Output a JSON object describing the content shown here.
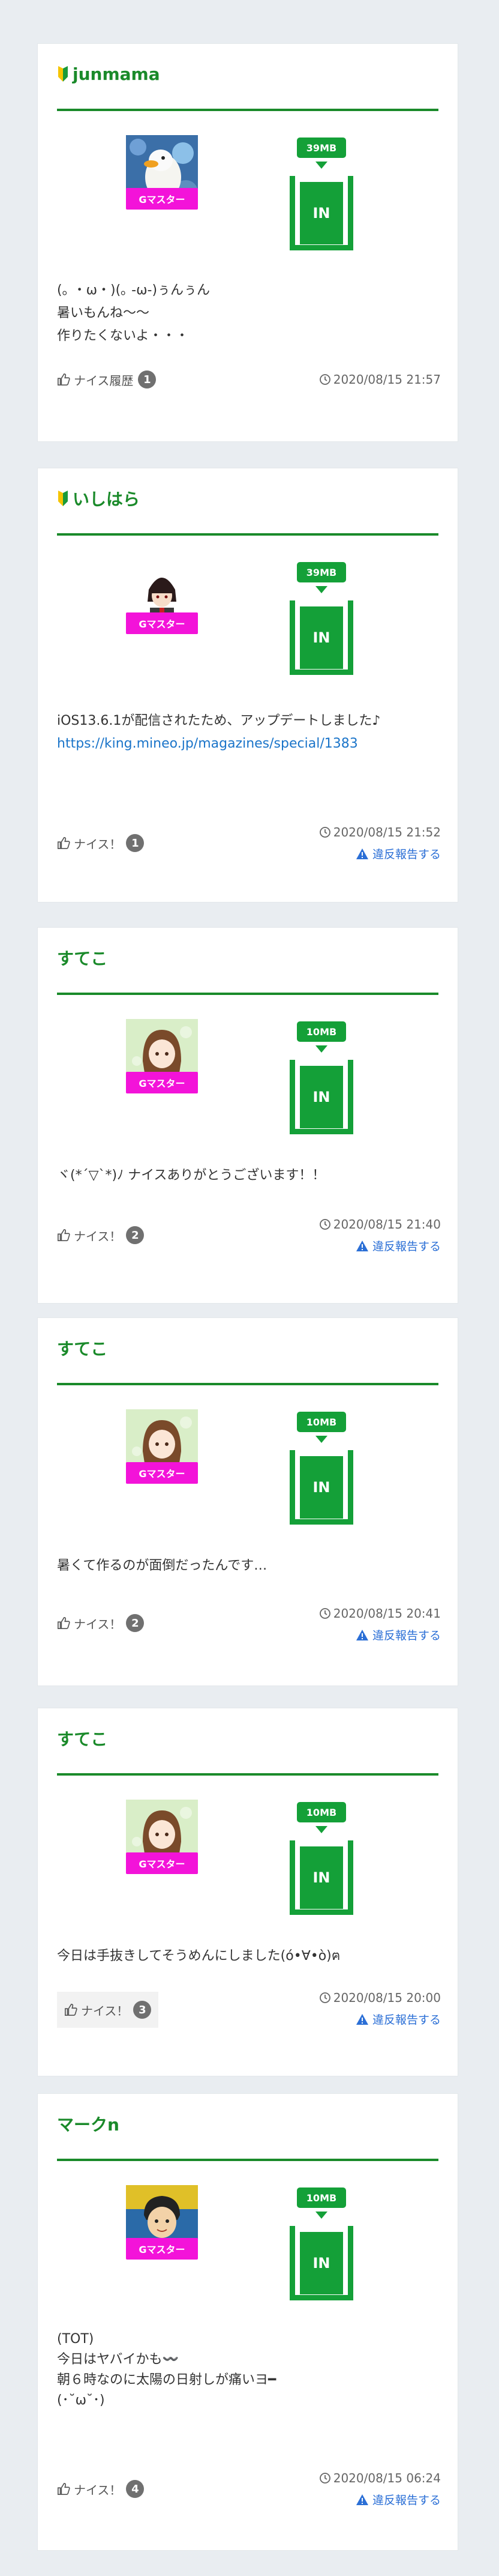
{
  "colors": {
    "accent": "#1a8a2a",
    "in_green": "#14a038",
    "badge_magenta": "#f313d9",
    "link": "#1a74c9"
  },
  "badge_label": "Gマスター",
  "in_label": "IN",
  "report_label": "違反報告する",
  "posts": [
    {
      "user": "junmama",
      "beginner_icon": true,
      "avatar_icon": "duck-avatar",
      "data_size": "39MB",
      "message_lines": [
        "(｡ ・ω・)(｡ -ω-)ぅんぅん",
        "暑いもんね〜〜",
        "作りたくないよ・・・"
      ],
      "nice_label": "ナイス履歴",
      "nice_count": "1",
      "date": "2020/08/15 21:57",
      "show_report": false
    },
    {
      "user": "いしはら",
      "beginner_icon": true,
      "avatar_icon": "anime-boy-avatar",
      "data_size": "39MB",
      "message_lines": [
        "iOS13.6.1が配信されたため、アップデートしました♪"
      ],
      "message_link": "https://king.mineo.jp/magazines/special/1383",
      "nice_label": "ナイス！",
      "nice_count": "1",
      "date": "2020/08/15 21:52",
      "show_report": true
    },
    {
      "user": "すてこ",
      "beginner_icon": false,
      "avatar_icon": "girl-avatar",
      "data_size": "10MB",
      "message_lines": [
        "ヾ(*´▽`*)ﾉ ナイスありがとうございます！！"
      ],
      "nice_label": "ナイス！",
      "nice_count": "2",
      "date": "2020/08/15 21:40",
      "show_report": true
    },
    {
      "user": "すてこ",
      "beginner_icon": false,
      "avatar_icon": "girl-avatar",
      "data_size": "10MB",
      "message_lines": [
        "暑くて作るのが面倒だったんです…"
      ],
      "nice_label": "ナイス！",
      "nice_count": "2",
      "date": "2020/08/15 20:41",
      "show_report": true
    },
    {
      "user": "すてこ",
      "beginner_icon": false,
      "avatar_icon": "girl-avatar",
      "data_size": "10MB",
      "message_lines": [
        "今日は手抜きしてそうめんにしました(ό•∀•ὸ)ฅ"
      ],
      "nice_label": "ナイス！",
      "nice_count": "3",
      "date": "2020/08/15 20:00",
      "show_report": true
    },
    {
      "user": "マークn",
      "beginner_icon": false,
      "avatar_icon": "cartoon-man-avatar",
      "data_size": "10MB",
      "message_lines": [
        "(TOT)",
        "今日はヤバイかも〰️",
        "朝６時なのに太陽の日射しが痛いヨ━",
        "(･˘ω˘･)"
      ],
      "nice_label": "ナイス！",
      "nice_count": "4",
      "date": "2020/08/15 06:24",
      "show_report": true
    }
  ]
}
